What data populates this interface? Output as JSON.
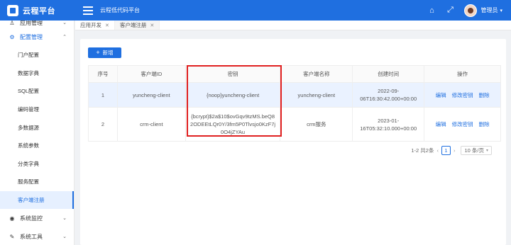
{
  "app": {
    "title": "云程平台",
    "platform": "云程低代码平台"
  },
  "header": {
    "user": "管理员"
  },
  "sidebar": {
    "groups": [
      {
        "label": "应用管理",
        "icon": "user-icon"
      },
      {
        "label": "配置管理",
        "icon": "gear-icon"
      },
      {
        "label": "系统监控",
        "icon": "eye-icon"
      },
      {
        "label": "系统工具",
        "icon": "wrench-icon"
      }
    ],
    "items": [
      "门户配置",
      "数据字典",
      "SQL配置",
      "编码管理",
      "多数据源",
      "系统参数",
      "分类字典",
      "服务配置",
      "客户端注册"
    ]
  },
  "tabs": [
    {
      "label": "应用开发"
    },
    {
      "label": "客户端注册"
    }
  ],
  "toolbar": {
    "add_label": "新增"
  },
  "table": {
    "headers": [
      "序号",
      "客户端ID",
      "密钥",
      "客户端名称",
      "创建时间",
      "操作"
    ],
    "rows": [
      {
        "no": "1",
        "client_id": "yuncheng-client",
        "secret": "{noop}yuncheng-client",
        "name": "yuncheng-client",
        "created": "2022-09-06T16:30:42.000+00:00"
      },
      {
        "no": "2",
        "client_id": "crm-client",
        "secret": "{bcrypt}$2a$10$ovGqv9tzMS.beQ82ODEEtLQr0Y/3fm5P0Tlvsjo0KzF7j0O4jZYAu",
        "name": "crm服务",
        "created": "2023-01-16T05:32:10.000+00:00"
      }
    ],
    "actions": {
      "edit": "编辑",
      "change_secret": "修改密钥",
      "delete": "删除"
    }
  },
  "pagination": {
    "summary": "1-2 共2条",
    "page": "1",
    "page_size": "10 条/页"
  },
  "colors": {
    "primary": "#1f6fe0",
    "highlight": "#e02020",
    "selected_row": "#eaf2ff"
  }
}
